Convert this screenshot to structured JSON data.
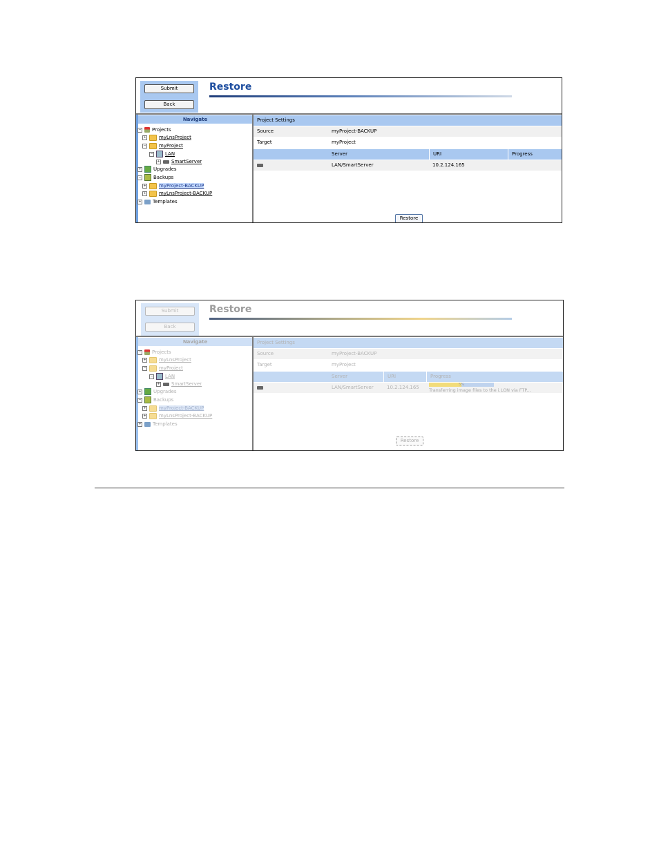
{
  "screen1": {
    "buttons": {
      "submit": "Submit",
      "back": "Back"
    },
    "title": "Restore",
    "navigate": "Navigate",
    "tree": {
      "projects": "Projects",
      "mylnsproject": "myLnsProject",
      "myproject": "myProject",
      "lan": "LAN",
      "smartserver": "SmartServer",
      "upgrades": "Upgrades",
      "backups": "Backups",
      "myproject_backup": "myProject-BACKUP",
      "mylnsproject_backup": "myLnsProject-BACKUP",
      "templates": "Templates"
    },
    "settings": {
      "header": "Project Settings",
      "source_label": "Source",
      "source_value": "myProject-BACKUP",
      "target_label": "Target",
      "target_value": "myProject",
      "col_server": "Server",
      "col_uri": "URI",
      "col_progress": "Progress",
      "row_server": "LAN/SmartServer",
      "row_uri": "10.2.124.165"
    },
    "restore_button": "Restore"
  },
  "screen2": {
    "buttons": {
      "submit": "Submit",
      "back": "Back"
    },
    "title": "Restore",
    "navigate": "Navigate",
    "tree": {
      "projects": "Projects",
      "mylnsproject": "myLnsProject",
      "myproject": "myProject",
      "lan": "LAN",
      "smartserver": "SmartServer",
      "upgrades": "Upgrades",
      "backups": "Backups",
      "myproject_backup": "myProject-BACKUP",
      "mylnsproject_backup": "myLnsProject-BACKUP",
      "templates": "Templates"
    },
    "settings": {
      "header": "Project Settings",
      "source_label": "Source",
      "source_value": "myProject-BACKUP",
      "target_label": "Target",
      "target_value": "myProject",
      "col_server": "Server",
      "col_uri": "URI",
      "col_progress": "Progress",
      "row_server": "LAN/SmartServer",
      "row_uri": "10.2.124.165",
      "progress_label": "5%",
      "progress_fraction": 0.05,
      "status": "Transferring image files to the i.LON via FTP..."
    },
    "restore_button": "Restore"
  }
}
